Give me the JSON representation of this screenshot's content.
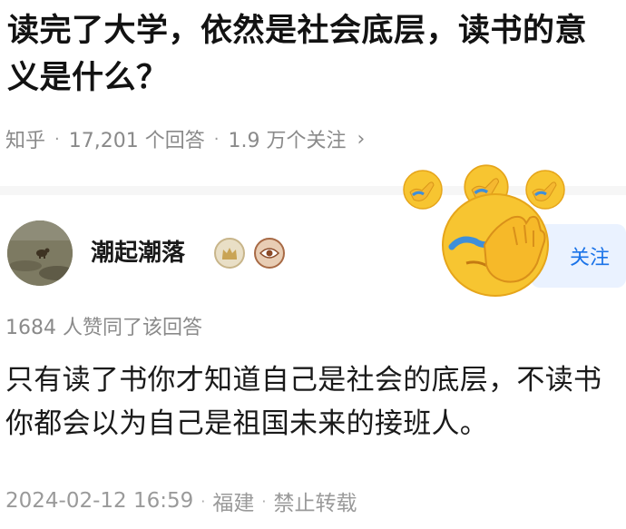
{
  "question": {
    "title": "读完了大学，依然是社会底层，读书的意义是什么？"
  },
  "meta": {
    "source": "知乎",
    "answers": "17,201 个回答",
    "followers": "1.9 万个关注",
    "chevron": "›"
  },
  "author": {
    "name": "潮起潮落",
    "follow_label": "关注"
  },
  "answer": {
    "likes": "1684 人赞同了该回答",
    "body": "只有读了书你才知道自己是社会的底层，不读书你都会以为自己是祖国未来的接班人。"
  },
  "footer": {
    "datetime": "2024-02-12 16:59",
    "location": "福建",
    "rights": "禁止转载"
  },
  "colors": {
    "link_blue": "#1a73e8",
    "meta_gray": "#8a8a8a",
    "emoji_yellow": "#f7c531"
  },
  "icons": [
    "crown-badge-icon",
    "eye-badge-icon",
    "facepalm-emoji"
  ]
}
